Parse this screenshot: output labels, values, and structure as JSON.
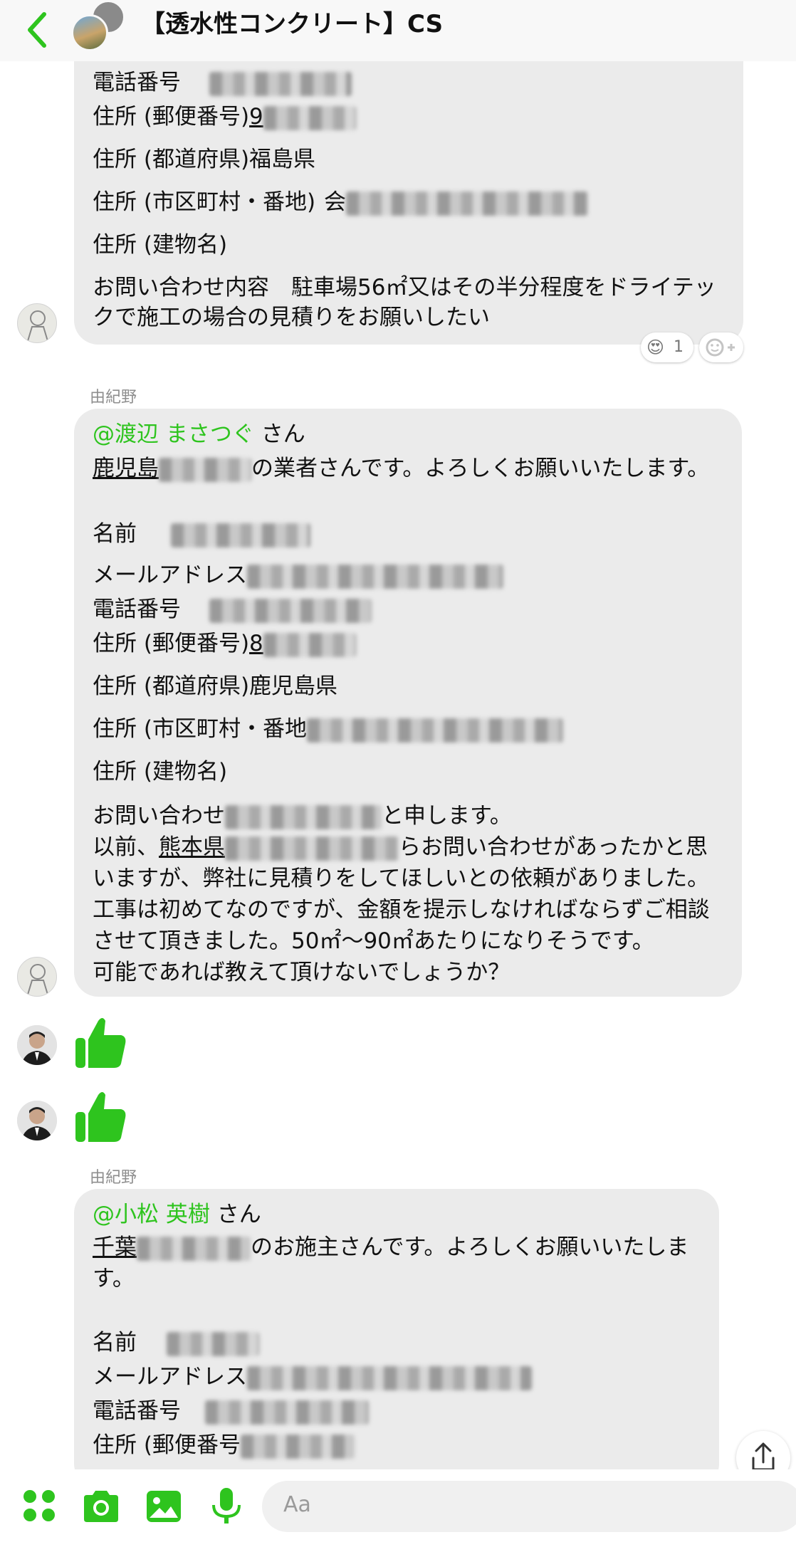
{
  "header": {
    "title": "【透水性コンクリート】CS"
  },
  "messages": {
    "m1": {
      "phone_label": "電話番号",
      "postal_label": "住所 (郵便番号)",
      "postal_start": "9",
      "prefecture_line": "住所 (都道府県)福島県",
      "city_label": "住所 (市区町村・番地)",
      "city_start": "会",
      "building_line": "住所 (建物名)",
      "inquiry_line1": "お問い合わせ内容　駐車場56㎡又はその半分程度をドライテッ",
      "inquiry_line2": "クで施工の場合の見積りをお願いしたい",
      "reaction_emoji": "😍",
      "reaction_count": "1"
    },
    "m2": {
      "sender": "由紀野",
      "mention": "@渡辺 まさつぐ",
      "san": " さん",
      "intro_start": "鹿児島",
      "intro_end": "の業者さんです。よろしくお願いいたします。",
      "name_label": "名前",
      "email_label": "メールアドレス",
      "phone_label": "電話番号",
      "postal_label": "住所 (郵便番号)",
      "postal_start": "8",
      "prefecture_line": "住所 (都道府県)鹿児島県",
      "city_label": "住所 (市区町村・番地",
      "building_line": "住所 (建物名)",
      "body_line1_start": "お問い合わせ",
      "body_line1_end": "と申します。",
      "body_line2_start": "以前、",
      "body_line2_ul": "熊本県",
      "body_line2_end": "らお問い合わせがあったかと思",
      "body_line3": "いますが、弊社に見積りをしてほしいとの依頼がありました。",
      "body_line4": "工事は初めてなのですが、金額を提示しなければならずご相談",
      "body_line5": "させて頂きました。50㎡〜90㎡あたりになりそうです。",
      "body_line6": "可能であれば教えて頂けないでしょうか？"
    },
    "m3": {
      "sender": "由紀野",
      "mention": "@小松 英樹",
      "san": " さん",
      "intro_start": "千葉",
      "intro_end": "のお施主さんです。よろしくお願いいたしま",
      "intro_line2": "す。",
      "name_label": "名前",
      "email_label": "メールアドレス",
      "phone_label": "電話番号",
      "postal_label": "住所 (郵便番号"
    }
  },
  "composer": {
    "placeholder": "Aa"
  },
  "colors": {
    "accent": "#2ec41e",
    "bubble": "#ebebeb",
    "sender": "#8e8e8e"
  },
  "icons": [
    "chevron-left-icon",
    "apps-icon",
    "camera-icon",
    "image-icon",
    "microphone-icon",
    "thumbs-up-icon",
    "share-icon",
    "add-reaction-icon"
  ]
}
